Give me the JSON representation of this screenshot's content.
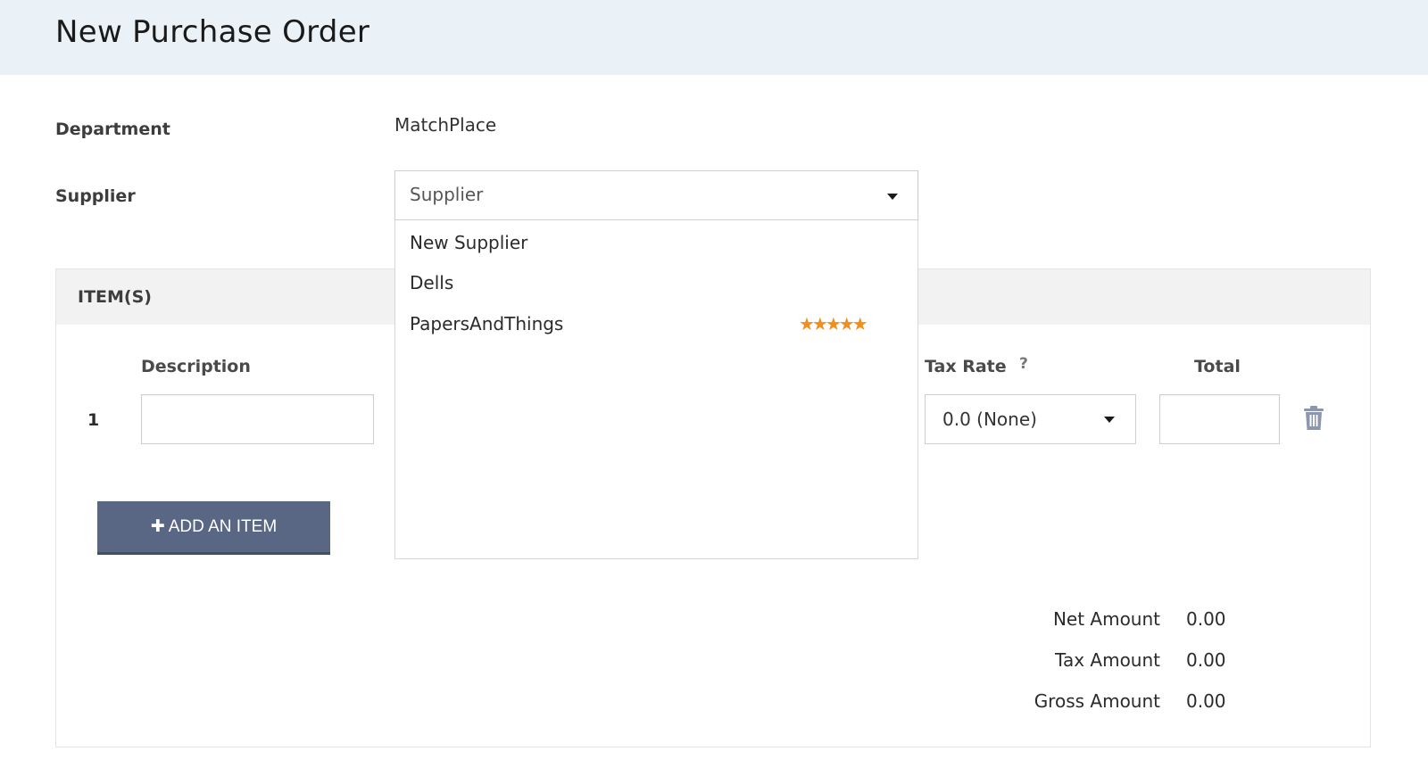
{
  "header": {
    "title": "New Purchase Order"
  },
  "form": {
    "department_label": "Department",
    "department_value": "MatchPlace",
    "supplier_label": "Supplier",
    "supplier_placeholder": "Supplier",
    "supplier_options": [
      {
        "label": "New Supplier",
        "rating": null
      },
      {
        "label": "Dells",
        "rating": null
      },
      {
        "label": "PapersAndThings",
        "rating": 5,
        "stars": "★★★★★"
      }
    ]
  },
  "items": {
    "title": "ITEM(S)",
    "columns": {
      "description": "Description",
      "tax_rate": "Tax Rate",
      "tax_help": "?",
      "total": "Total"
    },
    "rows": [
      {
        "index": "1",
        "description": "",
        "tax_rate": "0.0 (None)",
        "total": ""
      }
    ],
    "add_button_icon": "✚",
    "add_button_label": "ADD AN ITEM"
  },
  "summary": {
    "net_label": "Net Amount",
    "net_value": "0.00",
    "tax_label": "Tax Amount",
    "tax_value": "0.00",
    "gross_label": "Gross Amount",
    "gross_value": "0.00"
  },
  "colors": {
    "header_bg": "#eaf2f8",
    "button_bg": "#5a6784",
    "star": "#f18f1d",
    "trash": "#8c97ad"
  }
}
